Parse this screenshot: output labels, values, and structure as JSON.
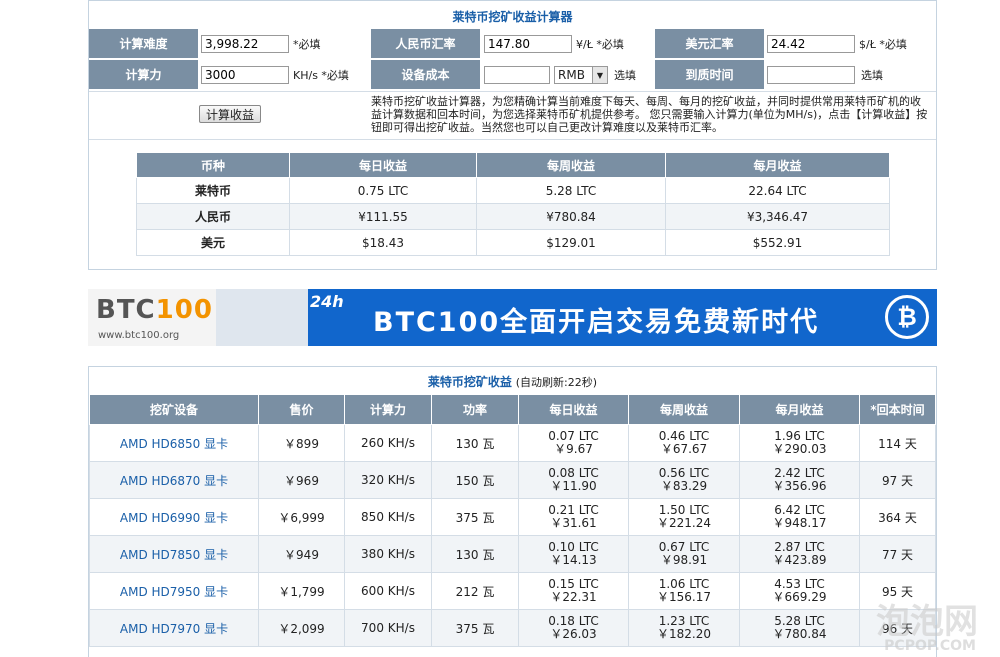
{
  "calc": {
    "title": "莱特币挖矿收益计算器",
    "labels": {
      "difficulty": "计算难度",
      "cny_rate": "人民币汇率",
      "usd_rate": "美元汇率",
      "hashrate": "计算力",
      "device_cost": "设备成本",
      "payback": "到质时间"
    },
    "values": {
      "difficulty": "3,998.22",
      "cny_rate": "147.80",
      "usd_rate": "24.42",
      "hashrate": "3000",
      "device_cost": "",
      "payback": ""
    },
    "suffixes": {
      "difficulty": "*必填",
      "cny_rate": "¥/Ł *必填",
      "usd_rate": "$/Ł *必填",
      "hashrate": "KH/s *必填",
      "device_cost": "选填",
      "payback": "选填"
    },
    "currency_select": "RMB",
    "button": "计算收益",
    "description": "莱特币挖矿收益计算器，为您精确计算当前难度下每天、每周、每月的挖矿收益，并同时提供常用莱特币矿机的收益计算数据和回本时间，为您选择莱特币矿机提供参考。 您只需要输入计算力(单位为MH/s)，点击【计算收益】按钮即可得出挖矿收益。当然您也可以自己更改计算难度以及莱特币汇率。"
  },
  "summary": {
    "headers": [
      "币种",
      "每日收益",
      "每周收益",
      "每月收益"
    ],
    "rows": [
      [
        "莱特币",
        "0.75 LTC",
        "5.28 LTC",
        "22.64 LTC"
      ],
      [
        "人民币",
        "¥111.55",
        "¥780.84",
        "¥3,346.47"
      ],
      [
        "美元",
        "$18.43",
        "$129.01",
        "$552.91"
      ]
    ]
  },
  "banner": {
    "logo_a": "BTC",
    "logo_b": "100",
    "url": "www.btc100.org",
    "tag": "24h",
    "headline": "BTC100全面开启交易免费新时代",
    "coin_symbol": "₿",
    "bg_color": "#1166cc"
  },
  "mining": {
    "title": "莱特币挖矿收益",
    "refresh": "(自动刷新:22秒)",
    "headers": [
      "挖矿设备",
      "售价",
      "计算力",
      "功率",
      "每日收益",
      "每周收益",
      "每月收益",
      "*回本时间"
    ],
    "rows": [
      {
        "device": "AMD HD6850 显卡",
        "price": "￥899",
        "hash": "260 KH/s",
        "power": "130 瓦",
        "d1": "0.07 LTC",
        "d2": "￥9.67",
        "w1": "0.46 LTC",
        "w2": "￥67.67",
        "m1": "1.96 LTC",
        "m2": "￥290.03",
        "payback": "114 天"
      },
      {
        "device": "AMD HD6870 显卡",
        "price": "￥969",
        "hash": "320 KH/s",
        "power": "150 瓦",
        "d1": "0.08 LTC",
        "d2": "￥11.90",
        "w1": "0.56 LTC",
        "w2": "￥83.29",
        "m1": "2.42 LTC",
        "m2": "￥356.96",
        "payback": "97 天"
      },
      {
        "device": "AMD HD6990 显卡",
        "price": "￥6,999",
        "hash": "850 KH/s",
        "power": "375 瓦",
        "d1": "0.21 LTC",
        "d2": "￥31.61",
        "w1": "1.50 LTC",
        "w2": "￥221.24",
        "m1": "6.42 LTC",
        "m2": "￥948.17",
        "payback": "364 天"
      },
      {
        "device": "AMD HD7850 显卡",
        "price": "￥949",
        "hash": "380 KH/s",
        "power": "130 瓦",
        "d1": "0.10 LTC",
        "d2": "￥14.13",
        "w1": "0.67 LTC",
        "w2": "￥98.91",
        "m1": "2.87 LTC",
        "m2": "￥423.89",
        "payback": "77 天"
      },
      {
        "device": "AMD HD7950 显卡",
        "price": "￥1,799",
        "hash": "600 KH/s",
        "power": "212 瓦",
        "d1": "0.15 LTC",
        "d2": "￥22.31",
        "w1": "1.06 LTC",
        "w2": "￥156.17",
        "m1": "4.53 LTC",
        "m2": "￥669.29",
        "payback": "95 天"
      },
      {
        "device": "AMD HD7970 显卡",
        "price": "￥2,099",
        "hash": "700 KH/s",
        "power": "375 瓦",
        "d1": "0.18 LTC",
        "d2": "￥26.03",
        "w1": "1.23 LTC",
        "w2": "￥182.20",
        "m1": "5.28 LTC",
        "m2": "￥780.84",
        "payback": "96 天"
      }
    ]
  },
  "watermark": {
    "cn": "泡泡网",
    "en": "PCPOP.COM"
  }
}
